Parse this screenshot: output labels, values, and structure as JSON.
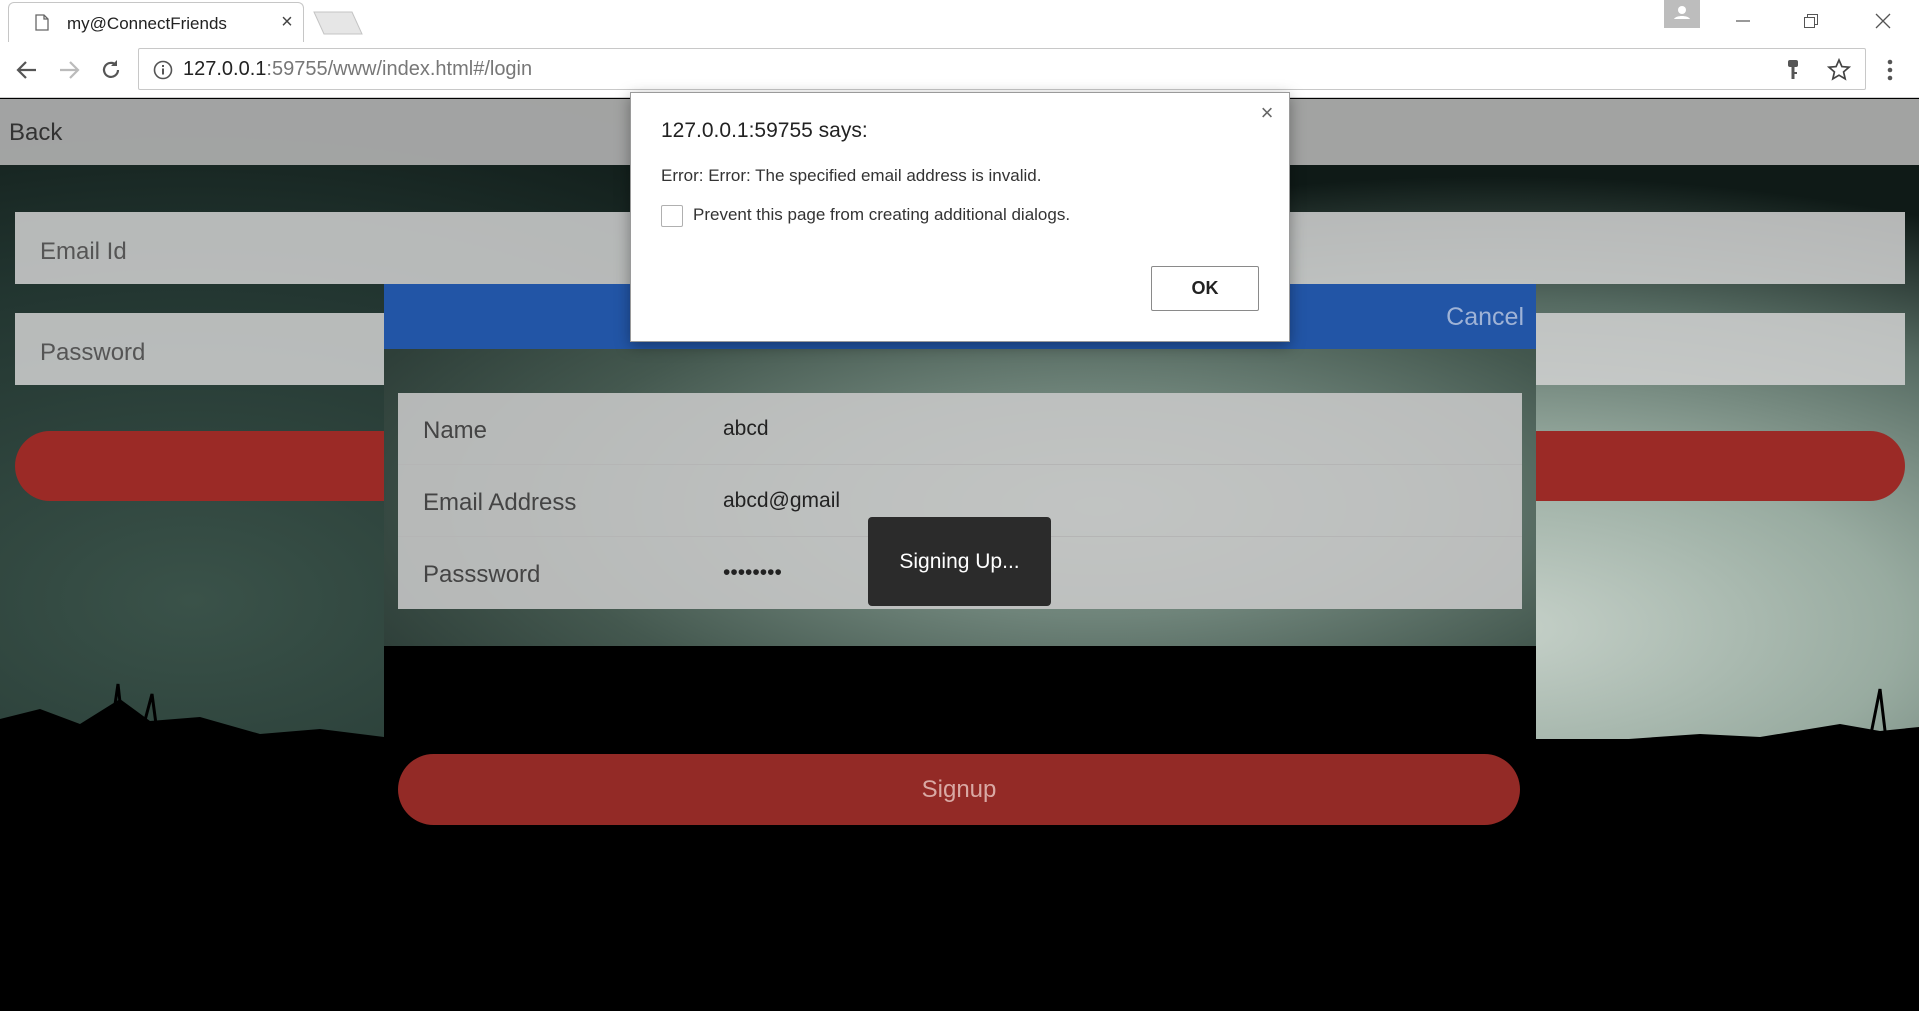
{
  "browser": {
    "tab_title": "my@ConnectFriends",
    "url_host": "127.0.0.1",
    "url_rest": ":59755/www/index.html#/login"
  },
  "page": {
    "back_label": "Back",
    "email_placeholder": "Email Id",
    "password_placeholder": "Password"
  },
  "modal": {
    "cancel_label": "Cancel",
    "fields": [
      {
        "label": "Name",
        "value": "abcd"
      },
      {
        "label": "Email Address",
        "value": "abcd@gmail"
      },
      {
        "label": "Passsword",
        "value": "••••••••"
      }
    ],
    "signup_label": "Signup",
    "loading_text": "Signing Up..."
  },
  "dialog": {
    "title": "127.0.0.1:59755 says:",
    "message": "Error: Error: The specified email address is invalid.",
    "checkbox_label": "Prevent this page from creating additional dialogs.",
    "checkbox_checked": false,
    "ok_label": "OK",
    "close_glyph": "×"
  },
  "colors": {
    "modal_header": "#2255a6",
    "signup_button": "#932a26",
    "login_button": "#9b2a26"
  }
}
